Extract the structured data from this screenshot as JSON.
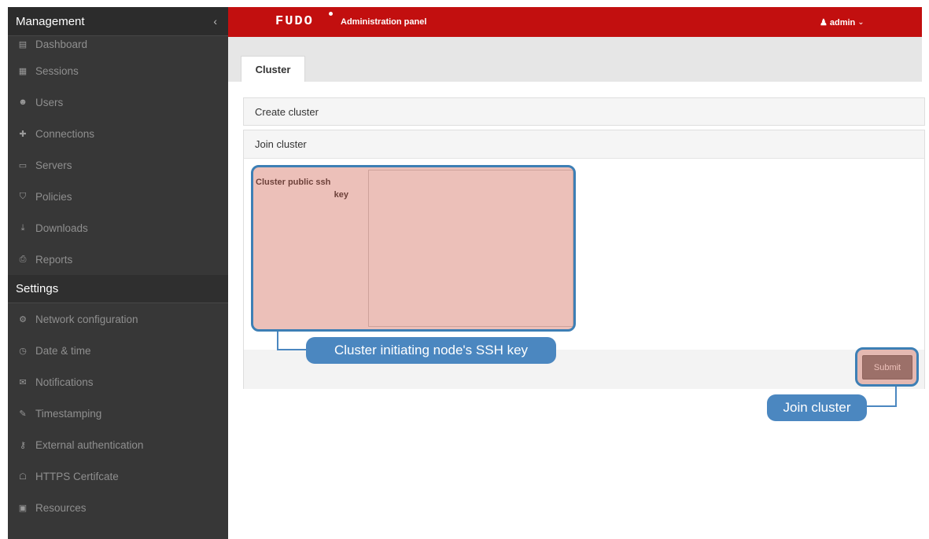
{
  "app": {
    "logo": "FUDO",
    "title": "Administration panel",
    "user": "admin"
  },
  "sidebar": {
    "management_heading": "Management",
    "collapse_glyph": "‹",
    "management_items": [
      {
        "label": "Dashboard",
        "icon": "chart-icon"
      },
      {
        "label": "Sessions",
        "icon": "film-icon"
      },
      {
        "label": "Users",
        "icon": "users-icon"
      },
      {
        "label": "Connections",
        "icon": "plus-icon"
      },
      {
        "label": "Servers",
        "icon": "server-icon"
      },
      {
        "label": "Policies",
        "icon": "shield-icon"
      },
      {
        "label": "Downloads",
        "icon": "download-icon"
      },
      {
        "label": "Reports",
        "icon": "printer-icon"
      }
    ],
    "settings_heading": "Settings",
    "settings_items": [
      {
        "label": "Network configuration",
        "icon": "gears-icon"
      },
      {
        "label": "Date & time",
        "icon": "clock-icon"
      },
      {
        "label": "Notifications",
        "icon": "envelope-icon"
      },
      {
        "label": "Timestamping",
        "icon": "edit-icon"
      },
      {
        "label": "External authentication",
        "icon": "key-icon"
      },
      {
        "label": "HTTPS Certifcate",
        "icon": "lock-icon"
      },
      {
        "label": "Resources",
        "icon": "picture-icon"
      }
    ]
  },
  "tabs": {
    "active": "Cluster"
  },
  "panels": {
    "create_label": "Create cluster",
    "join_label": "Join cluster"
  },
  "form": {
    "key_label_line1": "Cluster public ssh",
    "key_label_line2": "key",
    "key_value": "",
    "submit_label": "Submit"
  },
  "callouts": {
    "key": "Cluster initiating node's SSH key",
    "join": "Join cluster"
  },
  "colors": {
    "header": "#c20f0f",
    "sidebar": "#373737",
    "callout": "#4b87c0",
    "highlight": "#cc5a46"
  }
}
